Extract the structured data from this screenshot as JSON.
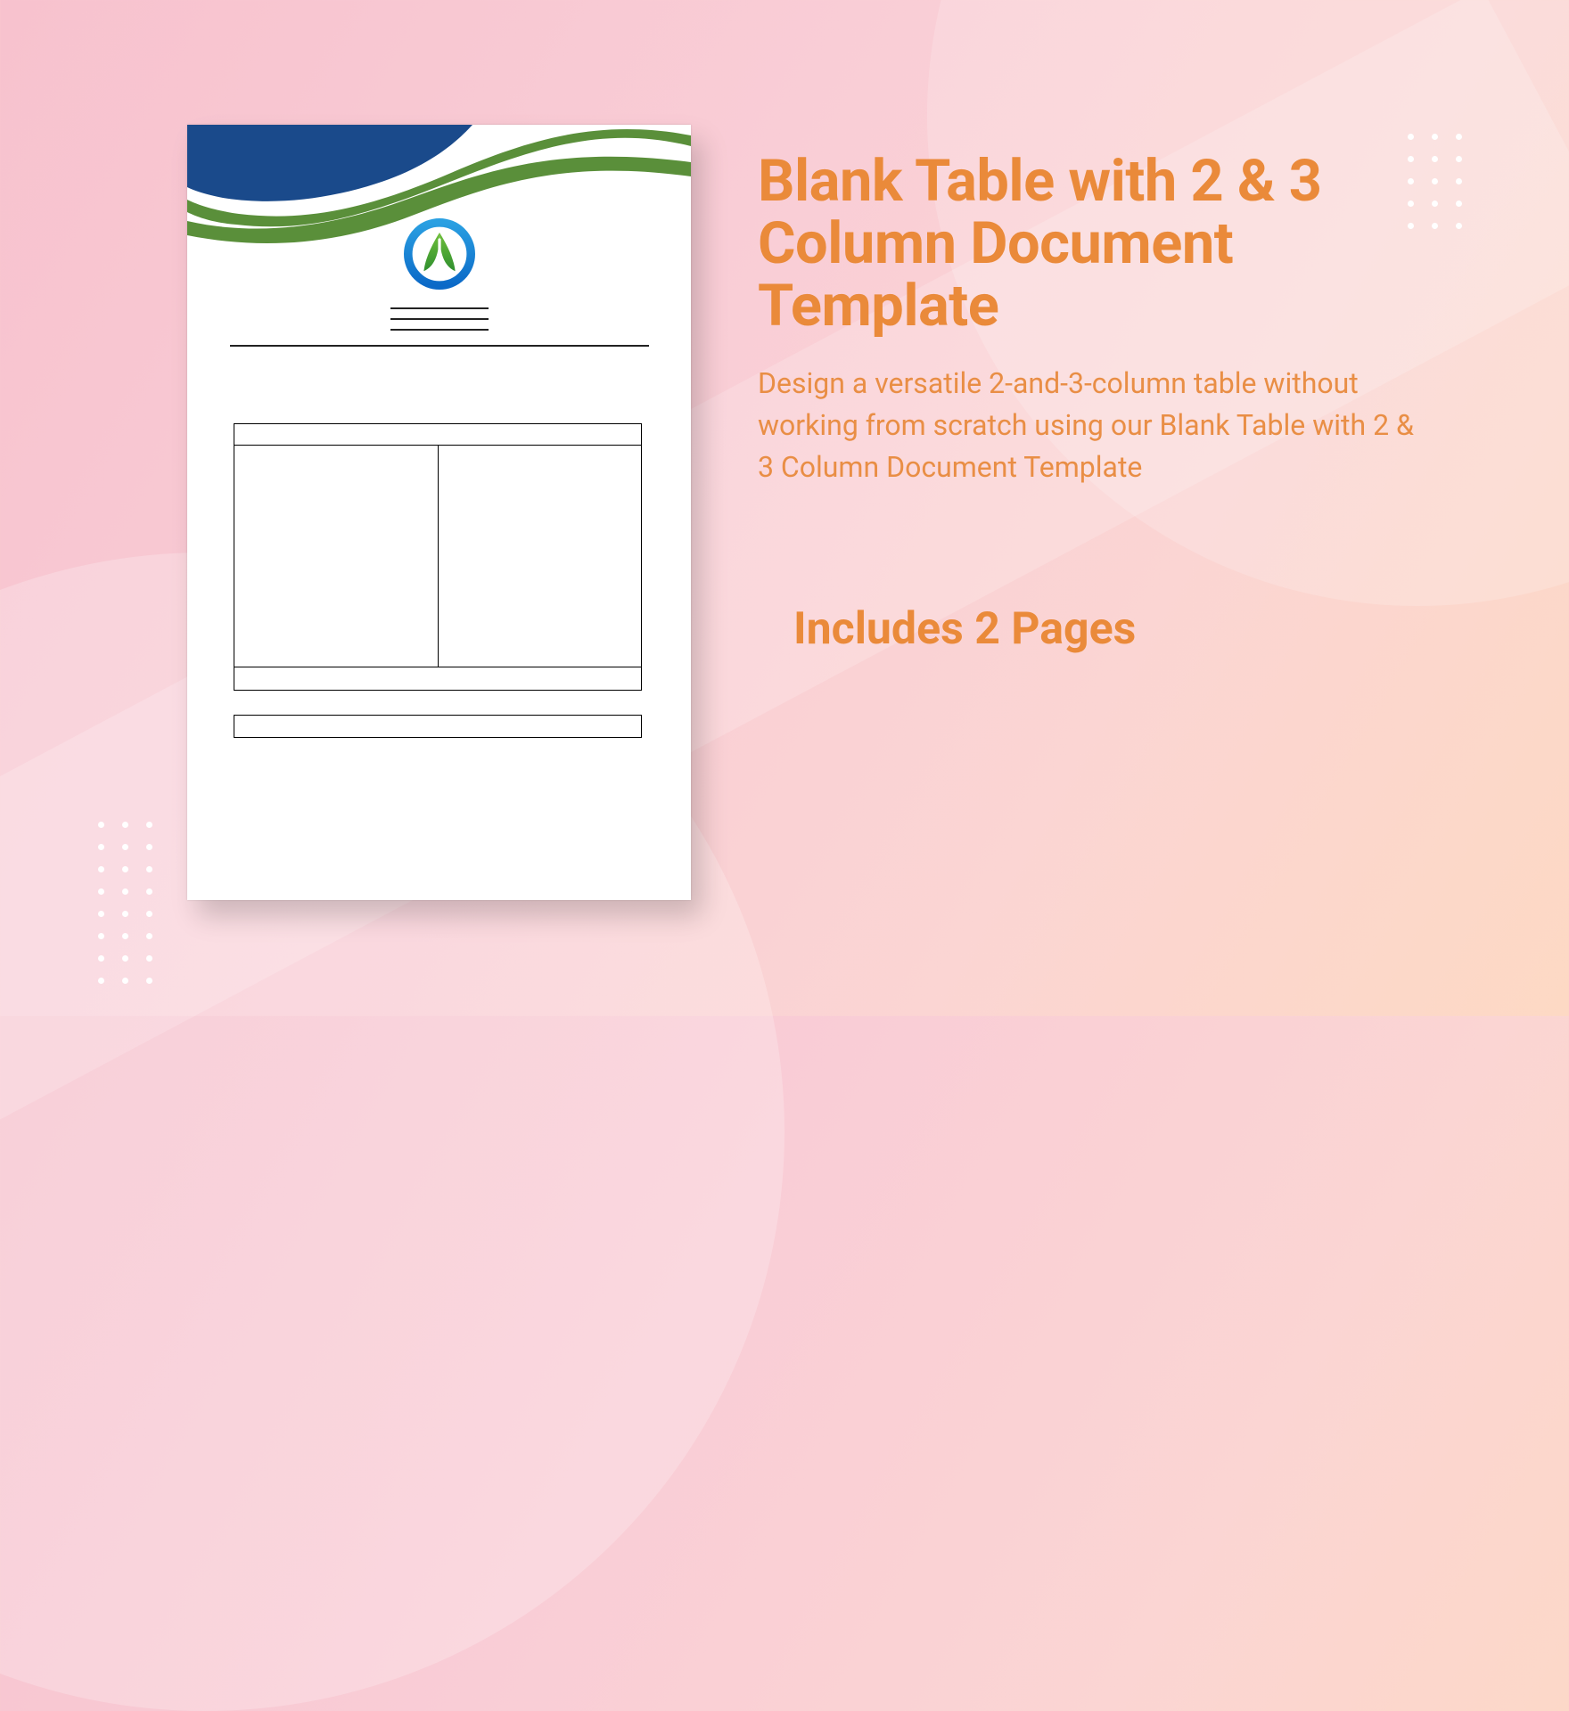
{
  "title": "Blank Table with 2 & 3 Column Document Template",
  "description": "Design a versatile 2-and-3-column table without working from scratch using our Blank Table with 2 & 3 Column Document Template",
  "includes_label": "Includes 2 Pages",
  "colors": {
    "accent": "#ea8a3a",
    "wave_blue": "#1a4a8b",
    "wave_green": "#5a8f3a"
  }
}
